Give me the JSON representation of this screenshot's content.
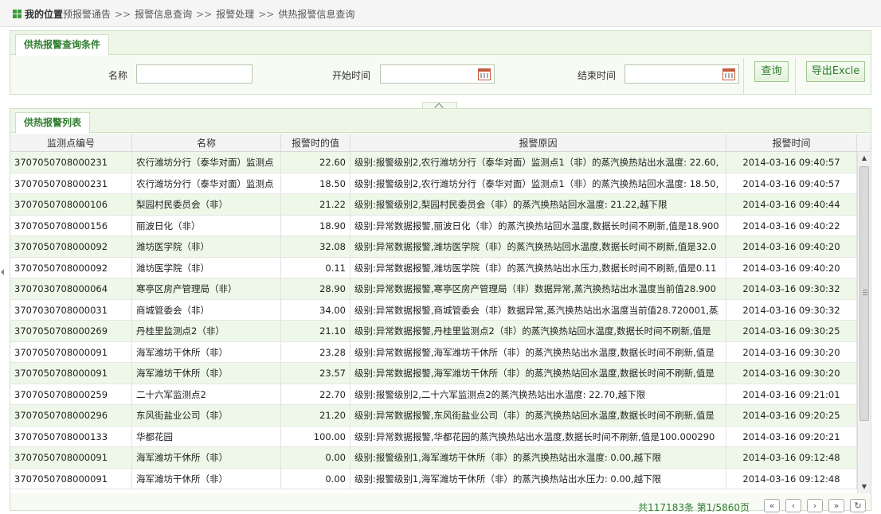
{
  "breadcrumb": {
    "root": "我的位置",
    "items": [
      "预报警通告",
      "报警信息查询",
      "报警处理",
      "供热报警信息查询"
    ],
    "separator": ">>"
  },
  "query_panel": {
    "tab": "供热报警查询条件",
    "name_label": "名称",
    "name_value": "",
    "start_label": "开始时间",
    "start_value": "",
    "end_label": "结束时间",
    "end_value": "",
    "query_button": "查询",
    "export_button": "导出Excle"
  },
  "list_panel": {
    "tab": "供热报警列表",
    "columns": [
      "监测点编号",
      "名称",
      "报警时的值",
      "报警原因",
      "报警时间"
    ],
    "rows": [
      {
        "id": "3707050708000231",
        "name": "农行潍坊分行（泰华对面）监测点",
        "value": "22.60",
        "reason": "级别:报警级别2,农行潍坊分行（泰华对面）监测点1（非）的蒸汽换热站出水温度: 22.60,",
        "time": "2014-03-16 09:40:57"
      },
      {
        "id": "3707050708000231",
        "name": "农行潍坊分行（泰华对面）监测点",
        "value": "18.50",
        "reason": "级别:报警级别2,农行潍坊分行（泰华对面）监测点1（非）的蒸汽换热站回水温度: 18.50,",
        "time": "2014-03-16 09:40:57"
      },
      {
        "id": "3707050708000106",
        "name": "梨园村民委员会（非）",
        "value": "21.22",
        "reason": "级别:报警级别2,梨园村民委员会（非）的蒸汽换热站回水温度: 21.22,越下限",
        "time": "2014-03-16 09:40:44"
      },
      {
        "id": "3707050708000156",
        "name": "丽波日化（非）",
        "value": "18.90",
        "reason": "级别:异常数据报警,丽波日化（非）的蒸汽换热站回水温度,数据长时间不刷新,值是18.900",
        "time": "2014-03-16 09:40:22"
      },
      {
        "id": "3707050708000092",
        "name": "潍坊医学院（非）",
        "value": "32.08",
        "reason": "级别:异常数据报警,潍坊医学院（非）的蒸汽换热站回水温度,数据长时间不刷新,值是32.0",
        "time": "2014-03-16 09:40:20"
      },
      {
        "id": "3707050708000092",
        "name": "潍坊医学院（非）",
        "value": "0.11",
        "reason": "级别:异常数据报警,潍坊医学院（非）的蒸汽换热站出水压力,数据长时间不刷新,值是0.11",
        "time": "2014-03-16 09:40:20"
      },
      {
        "id": "3707030708000064",
        "name": "寒亭区房产管理局（非）",
        "value": "28.90",
        "reason": "级别:异常数据报警,寒亭区房产管理局（非）数据异常,蒸汽换热站出水温度当前值28.900",
        "time": "2014-03-16 09:30:32"
      },
      {
        "id": "3707030708000031",
        "name": "商城管委会（非）",
        "value": "34.00",
        "reason": "级别:异常数据报警,商城管委会（非）数据异常,蒸汽换热站出水温度当前值28.720001,蒸",
        "time": "2014-03-16 09:30:32"
      },
      {
        "id": "3707050708000269",
        "name": "丹桂里监测点2（非）",
        "value": "21.10",
        "reason": "级别:异常数据报警,丹桂里监测点2（非）的蒸汽换热站回水温度,数据长时间不刷新,值是",
        "time": "2014-03-16 09:30:25"
      },
      {
        "id": "3707050708000091",
        "name": "海军潍坊干休所（非）",
        "value": "23.28",
        "reason": "级别:异常数据报警,海军潍坊干休所（非）的蒸汽换热站出水温度,数据长时间不刷新,值是",
        "time": "2014-03-16 09:30:20"
      },
      {
        "id": "3707050708000091",
        "name": "海军潍坊干休所（非）",
        "value": "23.57",
        "reason": "级别:异常数据报警,海军潍坊干休所（非）的蒸汽换热站回水温度,数据长时间不刷新,值是",
        "time": "2014-03-16 09:30:20"
      },
      {
        "id": "3707050708000259",
        "name": "二十六军监测点2",
        "value": "22.70",
        "reason": "级别:报警级别2,二十六军监测点2的蒸汽换热站出水温度: 22.70,越下限",
        "time": "2014-03-16 09:21:01"
      },
      {
        "id": "3707050708000296",
        "name": "东风街盐业公司（非）",
        "value": "21.20",
        "reason": "级别:异常数据报警,东风街盐业公司（非）的蒸汽换热站回水温度,数据长时间不刷新,值是",
        "time": "2014-03-16 09:20:25"
      },
      {
        "id": "3707050708000133",
        "name": "华都花园",
        "value": "100.00",
        "reason": "级别:异常数据报警,华都花园的蒸汽换热站出水温度,数据长时间不刷新,值是100.000290",
        "time": "2014-03-16 09:20:21"
      },
      {
        "id": "3707050708000091",
        "name": "海军潍坊干休所（非）",
        "value": "0.00",
        "reason": "级别:报警级别1,海军潍坊干休所（非）的蒸汽换热站出水温度: 0.00,越下限",
        "time": "2014-03-16 09:12:48"
      },
      {
        "id": "3707050708000091",
        "name": "海军潍坊干休所（非）",
        "value": "0.00",
        "reason": "级别:报警级别1,海军潍坊干休所（非）的蒸汽换热站出水压力: 0.00,越下限",
        "time": "2014-03-16 09:12:48"
      }
    ]
  },
  "pager": {
    "info": "共117183条 第1/5860页",
    "first": "«",
    "prev": "‹",
    "next": "›",
    "last": "»",
    "refresh": "↻"
  },
  "icons": {
    "breadcrumb": "grid-icon",
    "calendar": "calendar-icon",
    "collapse": "chevron-up-icon",
    "refresh": "refresh-icon"
  },
  "colors": {
    "accent": "#2e7d2e",
    "row_alt": "#eef8e8",
    "border": "#cfe0c5"
  }
}
